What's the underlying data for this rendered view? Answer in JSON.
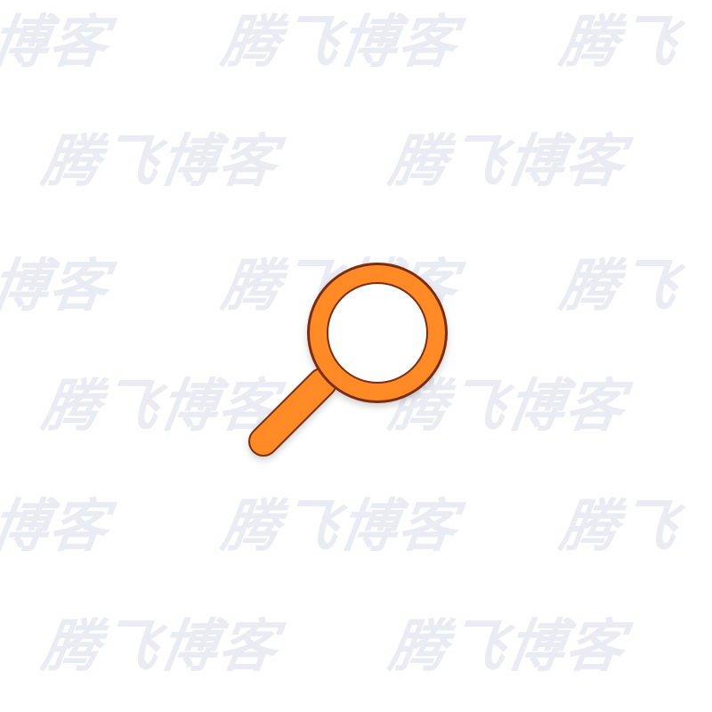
{
  "watermark": {
    "text": "腾飞博客",
    "partial_text": "博客",
    "partial_text_right": "腾飞",
    "color": "#e9ecf2"
  },
  "icon": {
    "name": "search-icon",
    "fill_color": "#ff8a26",
    "outline_color": "#7a2d12"
  }
}
